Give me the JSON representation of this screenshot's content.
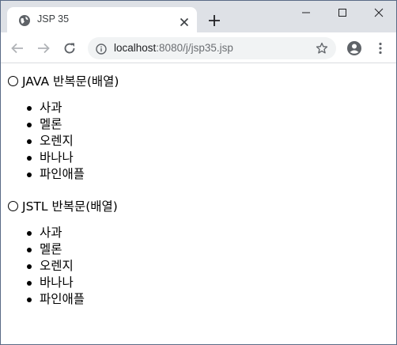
{
  "tab": {
    "title": "JSP 35"
  },
  "address_bar": {
    "host": "localhost",
    "path": ":8080/j/jsp35.jsp"
  },
  "icons": {
    "favicon": "globe-icon",
    "close": "close-icon",
    "new_tab": "plus-icon",
    "back": "arrow-left-icon",
    "forward": "arrow-right-icon",
    "reload": "reload-icon",
    "info": "info-icon",
    "bookmark": "star-icon",
    "profile": "account-icon",
    "menu": "kebab-menu-icon"
  },
  "colors": {
    "tabstrip": "#dee1e6",
    "omnibox": "#f1f3f4",
    "window_border": "#5a6b86"
  },
  "page": {
    "sections": [
      {
        "title": "JAVA 반복문(배열)",
        "items": [
          "사과",
          "멜론",
          "오렌지",
          "바나나",
          "파인애플"
        ]
      },
      {
        "title": "JSTL 반복문(배열)",
        "items": [
          "사과",
          "멜론",
          "오렌지",
          "바나나",
          "파인애플"
        ]
      }
    ]
  }
}
